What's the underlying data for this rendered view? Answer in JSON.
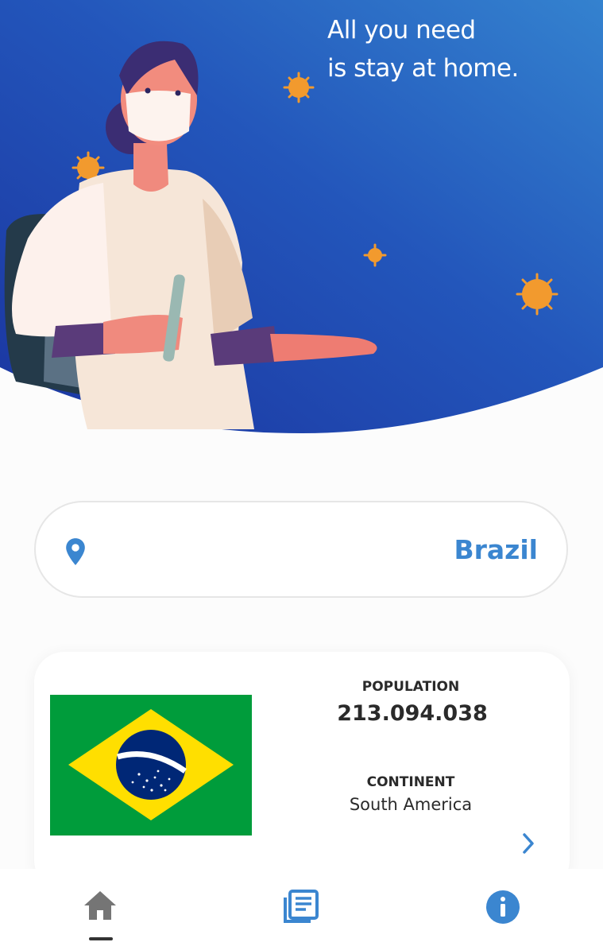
{
  "hero": {
    "line1": "All you need",
    "line2": "is stay at home."
  },
  "search": {
    "icon": "location-pin-icon",
    "country": "Brazil"
  },
  "country_card": {
    "flag": "brazil-flag",
    "population_label": "POPULATION",
    "population_value": "213.094.038",
    "continent_label": "CONTINENT",
    "continent_value": "South America",
    "details_icon": "chevron-right-icon"
  },
  "nav": {
    "items": [
      {
        "icon": "home-icon",
        "active": true
      },
      {
        "icon": "news-icon",
        "active": false
      },
      {
        "icon": "info-icon",
        "active": false
      }
    ]
  },
  "colors": {
    "accent": "#3b86d0",
    "hero_gradient_start": "#1f3fa8",
    "hero_gradient_end": "#3480cc",
    "virus": "#f29a2e",
    "text": "#2a2a2a"
  }
}
